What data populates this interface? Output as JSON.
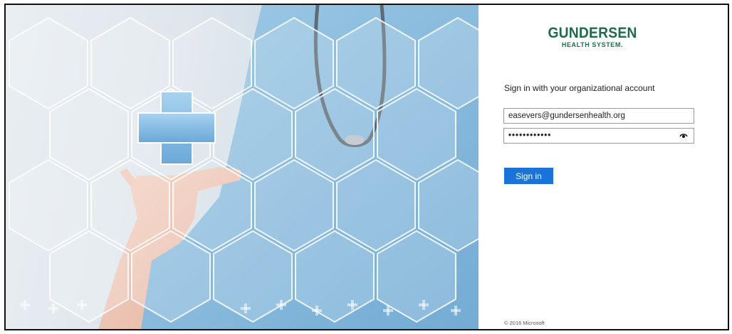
{
  "brand": {
    "name": "GUNDERSEN",
    "subtitle": "HEALTH SYSTEM.",
    "color": "#1f6b4a"
  },
  "signin": {
    "heading": "Sign in with your organizational account",
    "email_value": "easevers@gundersenhealth.org",
    "password_mask": "••••••••••••",
    "show_password_icon": "eye-icon",
    "button_label": "Sign in",
    "button_color": "#1a73d9"
  },
  "footer": {
    "copyright": "© 2016 Microsoft"
  }
}
